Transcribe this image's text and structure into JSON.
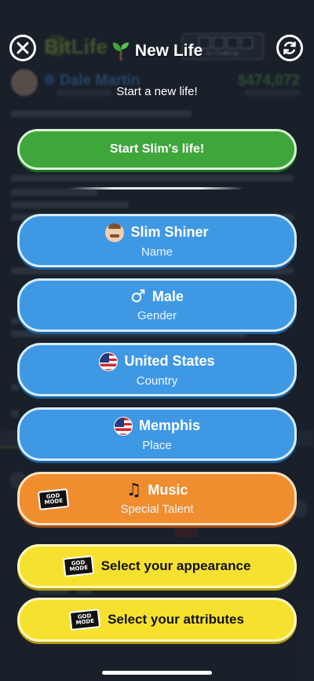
{
  "header": {
    "title": "New Life",
    "subtitle": "Start a new life!"
  },
  "start_button": {
    "label": "Start Slim's life!"
  },
  "options": [
    {
      "id": "name",
      "value": "Slim Shiner",
      "caption": "Name",
      "icon": "person-avatar-icon"
    },
    {
      "id": "gender",
      "value": "Male",
      "caption": "Gender",
      "icon": "male-symbol-icon"
    },
    {
      "id": "country",
      "value": "United States",
      "caption": "Country",
      "icon": "us-flag-icon"
    },
    {
      "id": "place",
      "value": "Memphis",
      "caption": "Place",
      "icon": "us-flag-icon"
    },
    {
      "id": "talent",
      "value": "Music",
      "caption": "Special Talent",
      "icon": "music-note-icon"
    }
  ],
  "god_mode_badge": "GOD MODE",
  "appearance_button": {
    "label": "Select your appearance"
  },
  "attributes_button": {
    "label": "Select your attributes"
  },
  "background": {
    "app_name": "BitLife",
    "character_name": "Dale Martin",
    "money": "$474,072",
    "challenge_label": "An Challenge"
  },
  "colors": {
    "green": "#3fa63b",
    "blue": "#3f98e3",
    "orange": "#f08d2e",
    "yellow": "#f7e12f",
    "backdrop": "#1e2630"
  }
}
